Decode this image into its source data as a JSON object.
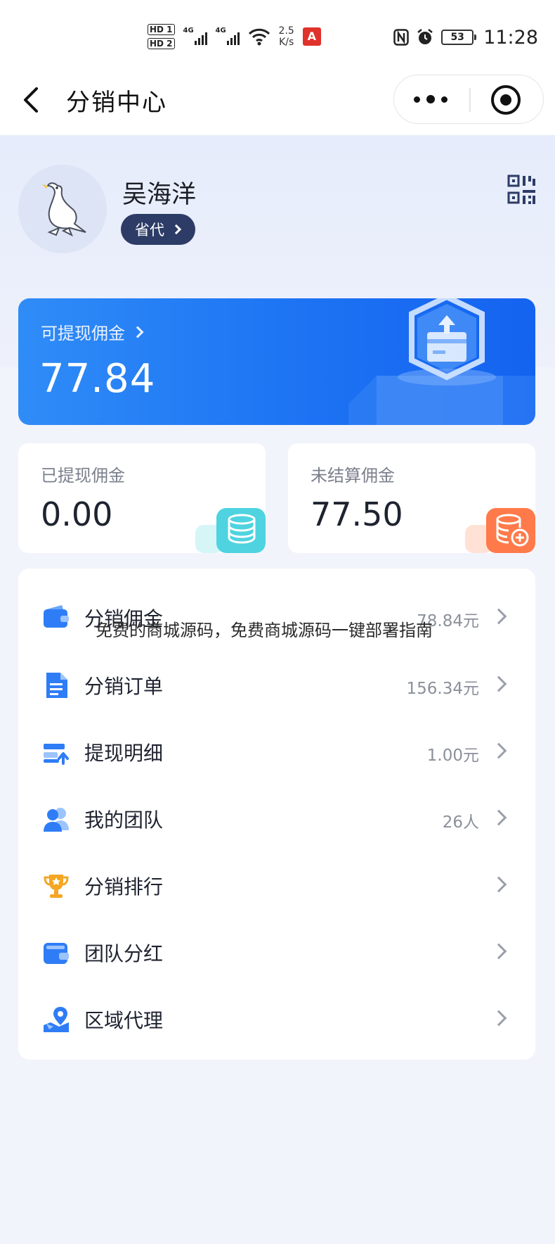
{
  "status_bar": {
    "hd1": "HD 1",
    "hd2": "HD 2",
    "signal1": "4G",
    "signal2": "4G",
    "speed_value": "2.5",
    "speed_unit": "K/s",
    "app_badge": "A",
    "battery": "53",
    "time": "11:28"
  },
  "nav": {
    "title": "分销中心"
  },
  "user": {
    "name": "吴海洋",
    "level": "省代"
  },
  "commission": {
    "withdrawable_label": "可提现佣金",
    "withdrawable_value": "77.84",
    "withdrawn_label": "已提现佣金",
    "withdrawn_value": "0.00",
    "unsettled_label": "未结算佣金",
    "unsettled_value": "77.50"
  },
  "colors": {
    "primary_blue": "#1d73f3",
    "badge_navy": "#2d3c66",
    "cyan_accent": "#4fd3e0",
    "orange_accent": "#ff7a4a"
  },
  "menu": [
    {
      "label": "分销佣金",
      "value": "78.84元",
      "icon": "wallet-icon"
    },
    {
      "label": "分销订单",
      "value": "156.34元",
      "icon": "document-icon"
    },
    {
      "label": "提现明细",
      "value": "1.00元",
      "icon": "card-transfer-icon"
    },
    {
      "label": "我的团队",
      "value": "26人",
      "icon": "team-icon"
    },
    {
      "label": "分销排行",
      "value": "",
      "icon": "trophy-icon"
    },
    {
      "label": "团队分红",
      "value": "",
      "icon": "purse-icon"
    },
    {
      "label": "区域代理",
      "value": "",
      "icon": "map-pin-icon"
    }
  ],
  "watermark": "免费的商城源码，免费商城源码一键部署指南"
}
